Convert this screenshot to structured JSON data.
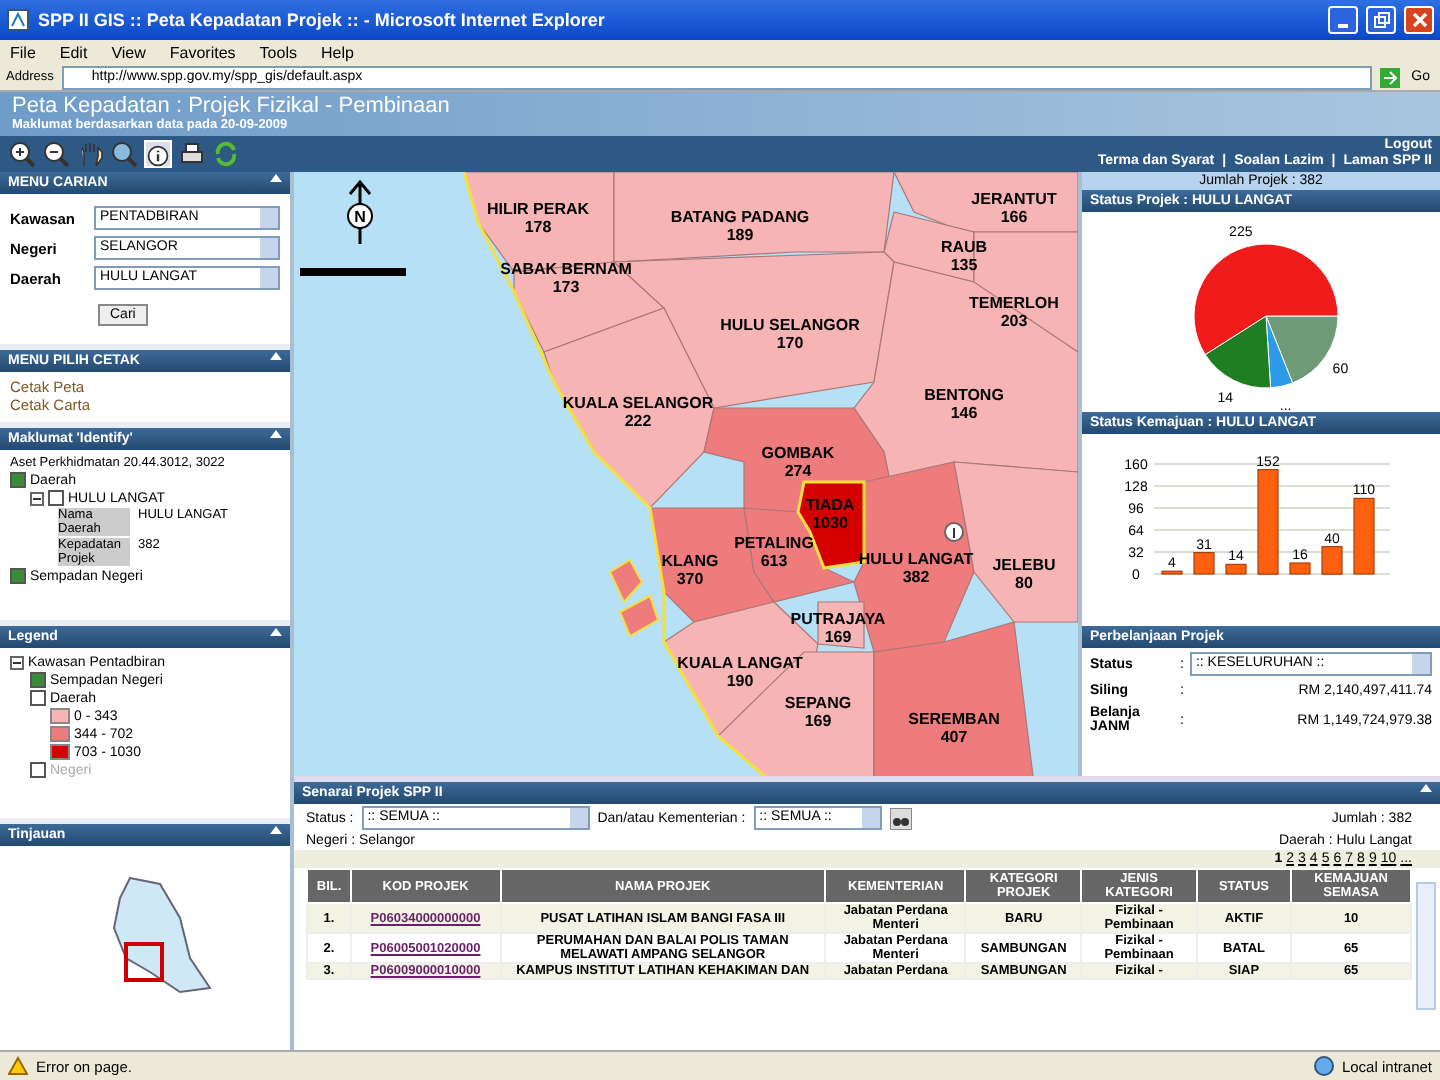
{
  "window": {
    "title": "SPP II GIS :: Peta Kepadatan Projek :: - Microsoft Internet Explorer"
  },
  "menu": [
    "File",
    "Edit",
    "View",
    "Favorites",
    "Tools",
    "Help"
  ],
  "address_bar": {
    "label": "Address",
    "url": "http://www.spp.gov.my/spp_gis/default.aspx",
    "go": "Go"
  },
  "header": {
    "title": "Peta Kepadatan : Projek Fizikal - Pembinaan",
    "subtitle": "Maklumat berdasarkan data pada 20-09-2009"
  },
  "top_links": {
    "logout": "Logout",
    "separator": "|",
    "links": [
      "Terma dan Syarat",
      "Soalan Lazim",
      "Laman SPP II"
    ]
  },
  "search_panel": {
    "title": "MENU CARIAN",
    "fields": [
      {
        "label": "Kawasan",
        "value": "PENTADBIRAN"
      },
      {
        "label": "Negeri",
        "value": "SELANGOR"
      },
      {
        "label": "Daerah",
        "value": "HULU LANGAT"
      }
    ],
    "button": "Cari"
  },
  "print_panel": {
    "title": "MENU PILIH CETAK",
    "links": [
      "Cetak Peta",
      "Cetak Carta"
    ]
  },
  "identify_panel": {
    "title": "Maklumat 'Identify'",
    "caption": "Aset Perkhidmatan 20.44.3012, 3022",
    "tree": [
      {
        "label": "Daerah",
        "checked": true,
        "children": [
          {
            "label": "HULU LANGAT",
            "checked": false,
            "expanded": true,
            "attributes": [
              {
                "name": "Nama Daerah",
                "value": "HULU LANGAT"
              },
              {
                "name": "Kepadatan Projek",
                "value": "382"
              }
            ]
          }
        ]
      },
      {
        "label": "Sempadan Negeri",
        "checked": true
      }
    ]
  },
  "legend_panel": {
    "title": "Legend",
    "root": {
      "label": "Kawasan Pentadbiran",
      "expanded": true,
      "children": [
        {
          "label": "Sempadan Negeri",
          "checked": true,
          "disabled": false
        },
        {
          "label": "Daerah",
          "checked": false,
          "disabled": false,
          "classes": [
            {
              "label": "0 - 343",
              "color": "#f7b4b4"
            },
            {
              "label": "344 - 702",
              "color": "#ee7c7c"
            },
            {
              "label": "703 - 1030",
              "color": "#d40000"
            }
          ]
        },
        {
          "label": "Negeri",
          "checked": false,
          "disabled": true
        }
      ]
    }
  },
  "overview_panel": {
    "title": "Tinjauan"
  },
  "map": {
    "north_label": "N",
    "districts": [
      {
        "name": "HILIR PERAK",
        "value": "178",
        "color": "#f7b4b4"
      },
      {
        "name": "BATANG PADANG",
        "value": "189",
        "color": "#f7b4b4"
      },
      {
        "name": "JERANTUT",
        "value": "166",
        "color": "#f7b4b4"
      },
      {
        "name": "RAUB",
        "value": "135",
        "color": "#f7b4b4"
      },
      {
        "name": "SABAK BERNAM",
        "value": "173",
        "color": "#f7b4b4"
      },
      {
        "name": "TEMERLOH",
        "value": "203",
        "color": "#f7b4b4"
      },
      {
        "name": "HULU SELANGOR",
        "value": "170",
        "color": "#f7b4b4"
      },
      {
        "name": "KUALA SELANGOR",
        "value": "222",
        "color": "#f7b4b4"
      },
      {
        "name": "BENTONG",
        "value": "146",
        "color": "#f7b4b4"
      },
      {
        "name": "GOMBAK",
        "value": "274",
        "color": "#ee7c7c"
      },
      {
        "name": "TIADA",
        "value": "1030",
        "color": "#d40000"
      },
      {
        "name": "KLANG",
        "value": "370",
        "color": "#ee7c7c"
      },
      {
        "name": "PETALING",
        "value": "613",
        "color": "#ee7c7c"
      },
      {
        "name": "HULU LANGAT",
        "value": "382",
        "color": "#ee7c7c"
      },
      {
        "name": "JELEBU",
        "value": "80",
        "color": "#f7b4b4"
      },
      {
        "name": "PUTRAJAYA",
        "value": "169",
        "color": "#f7b4b4"
      },
      {
        "name": "KUALA LANGAT",
        "value": "190",
        "color": "#f7b4b4"
      },
      {
        "name": "SEPANG",
        "value": "169",
        "color": "#f7b4b4"
      },
      {
        "name": "SEREMBAN",
        "value": "407",
        "color": "#ee7c7c"
      }
    ]
  },
  "summary": {
    "total": "Jumlah Projek : 382"
  },
  "status_chart": {
    "title": "Status Projek : HULU LANGAT",
    "slices": [
      {
        "label": "60",
        "color": "#6f9a78"
      },
      {
        "label": "...",
        "color": "#2b9be8"
      },
      {
        "label": "14",
        "color": "#1f7d23"
      },
      {
        "label": "225",
        "color": "#f01c1c"
      }
    ]
  },
  "progress_chart": {
    "title": "Status Kemajuan : HULU LANGAT",
    "chart_data": {
      "type": "bar",
      "categories": [
        null,
        null,
        null,
        null,
        null,
        null,
        null
      ],
      "series": [
        {
          "color": "#ff6010",
          "values": [
            4,
            31,
            14,
            152,
            16,
            40,
            110
          ]
        }
      ],
      "ylim": [
        0,
        160
      ],
      "yticks": [
        0,
        32,
        64,
        96,
        128,
        160
      ],
      "grid": true,
      "data_labels": true
    }
  },
  "spending": {
    "title": "Perbelanjaan Projek",
    "rows": [
      {
        "kind": "select",
        "label": "Status",
        "separator": ":",
        "value": ":: KESELURUHAN ::"
      },
      {
        "kind": "amount",
        "label": "Siling",
        "separator": ":",
        "value": "RM 2,140,497,411.74"
      },
      {
        "kind": "amount",
        "label": "Belanja JANM",
        "separator": ":",
        "value": "RM 1,149,724,979.38"
      }
    ]
  },
  "project_list": {
    "title": "Senarai Projek SPP II",
    "status_label": "Status :",
    "status_value": ":: SEMUA ::",
    "ministry_label": "Dan/atau Kementerian :",
    "ministry_value": ":: SEMUA ::",
    "total": "Jumlah : 382",
    "state": "Negeri : Selangor",
    "district": "Daerah : Hulu Langat",
    "pages": [
      {
        "label": "1",
        "selected": true
      },
      {
        "label": "2",
        "selected": false
      },
      {
        "label": "3",
        "selected": false
      },
      {
        "label": "4",
        "selected": false
      },
      {
        "label": "5",
        "selected": false
      },
      {
        "label": "6",
        "selected": false
      },
      {
        "label": "7",
        "selected": false
      },
      {
        "label": "8",
        "selected": false
      },
      {
        "label": "9",
        "selected": false
      },
      {
        "label": "10",
        "selected": false
      },
      {
        "label": "...",
        "selected": false
      }
    ],
    "columns": [
      "BIL.",
      "KOD PROJEK",
      "NAMA PROJEK",
      "KEMENTERIAN",
      "KATEGORI PROJEK",
      "JENIS KATEGORI",
      "STATUS",
      "KEMAJUAN SEMASA"
    ],
    "rows": [
      [
        "1.",
        "P06034000000000",
        "PUSAT LATIHAN ISLAM BANGI FASA III",
        "Jabatan Perdana Menteri",
        "BARU",
        "Fizikal - Pembinaan",
        "AKTIF",
        "10"
      ],
      [
        "2.",
        "P06005001020000",
        "PERUMAHAN DAN BALAI POLIS TAMAN MELAWATI AMPANG SELANGOR",
        "Jabatan Perdana Menteri",
        "SAMBUNGAN",
        "Fizikal - Pembinaan",
        "BATAL",
        "65"
      ],
      [
        "3.",
        "P06009000010000",
        "KAMPUS INSTITUT LATIHAN KEHAKIMAN DAN",
        "Jabatan Perdana",
        "SAMBUNGAN",
        "Fizikal -",
        "SIAP",
        "65"
      ]
    ]
  },
  "status_bar": {
    "text": "Error on page.",
    "zone": "Local intranet"
  }
}
